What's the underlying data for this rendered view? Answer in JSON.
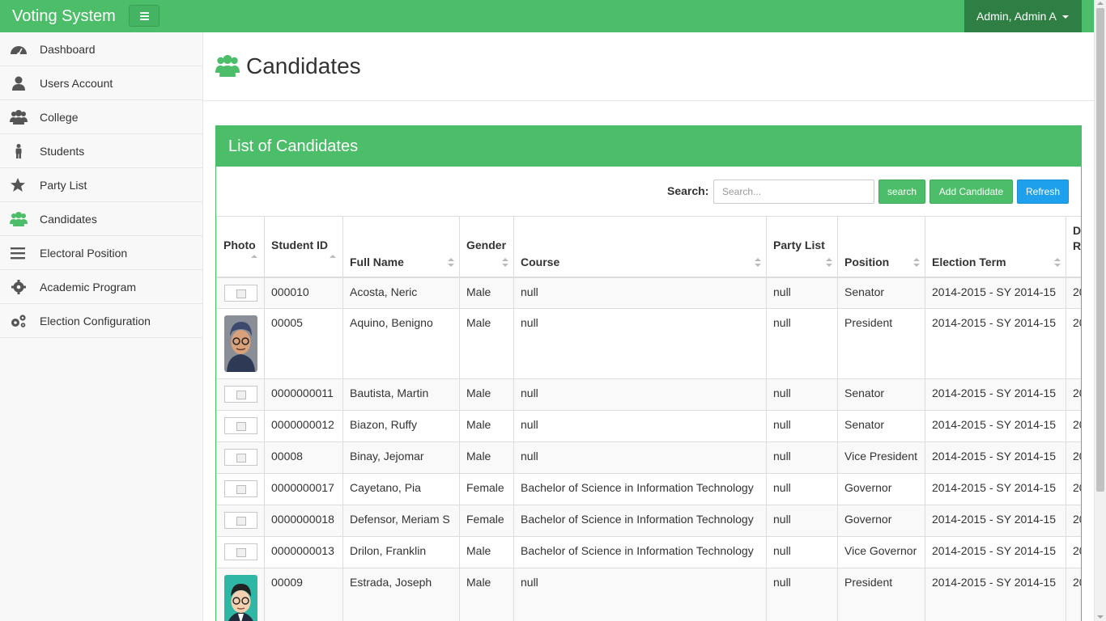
{
  "navbar": {
    "brand": "Voting System",
    "user": "Admin, Admin A"
  },
  "sidebar": {
    "items": [
      {
        "label": "Dashboard",
        "icon": "dashboard-icon"
      },
      {
        "label": "Users Account",
        "icon": "user-icon"
      },
      {
        "label": "College",
        "icon": "users-icon"
      },
      {
        "label": "Students",
        "icon": "male-icon"
      },
      {
        "label": "Party List",
        "icon": "star-icon"
      },
      {
        "label": "Candidates",
        "icon": "users-icon",
        "active": true
      },
      {
        "label": "Electoral Position",
        "icon": "bars-icon"
      },
      {
        "label": "Academic Program",
        "icon": "cog-icon"
      },
      {
        "label": "Election Configuration",
        "icon": "cogs-icon"
      }
    ]
  },
  "page": {
    "title": "Candidates"
  },
  "panel": {
    "title": "List of Candidates",
    "search_label": "Search:",
    "search_placeholder": "Search...",
    "search_value": "",
    "search_button": "search",
    "add_button": "Add Candidate",
    "refresh_button": "Refresh"
  },
  "table": {
    "columns": [
      "Photo",
      "Student ID",
      "Full Name",
      "Gender",
      "Course",
      "Party List",
      "Position",
      "Election Term",
      "Da Re"
    ],
    "last_col_line1": "D",
    "last_col_line2": "R",
    "rows": [
      {
        "photo": "none",
        "id": "000010",
        "name": "Acosta, Neric",
        "gender": "Male",
        "course": "null",
        "party": "null",
        "position": "Senator",
        "term": "2014-2015 - SY 2014-15",
        "extra": "20"
      },
      {
        "photo": "person-a",
        "id": "00005",
        "name": "Aquino, Benigno",
        "gender": "Male",
        "course": "null",
        "party": "null",
        "position": "President",
        "term": "2014-2015 - SY 2014-15",
        "extra": "20"
      },
      {
        "photo": "none",
        "id": "0000000011",
        "name": "Bautista, Martin",
        "gender": "Male",
        "course": "null",
        "party": "null",
        "position": "Senator",
        "term": "2014-2015 - SY 2014-15",
        "extra": "20"
      },
      {
        "photo": "none",
        "id": "0000000012",
        "name": "Biazon, Ruffy",
        "gender": "Male",
        "course": "null",
        "party": "null",
        "position": "Senator",
        "term": "2014-2015 - SY 2014-15",
        "extra": "20"
      },
      {
        "photo": "none",
        "id": "00008",
        "name": "Binay, Jejomar",
        "gender": "Male",
        "course": "null",
        "party": "null",
        "position": "Vice President",
        "term": "2014-2015 - SY 2014-15",
        "extra": "20"
      },
      {
        "photo": "none",
        "id": "0000000017",
        "name": "Cayetano, Pia",
        "gender": "Female",
        "course": "Bachelor of Science in Information Technology",
        "party": "null",
        "position": "Governor",
        "term": "2014-2015 - SY 2014-15",
        "extra": "20"
      },
      {
        "photo": "none",
        "id": "0000000018",
        "name": "Defensor, Meriam S",
        "gender": "Female",
        "course": "Bachelor of Science in Information Technology",
        "party": "null",
        "position": "Governor",
        "term": "2014-2015 - SY 2014-15",
        "extra": "20"
      },
      {
        "photo": "none",
        "id": "0000000013",
        "name": "Drilon, Franklin",
        "gender": "Male",
        "course": "Bachelor of Science in Information Technology",
        "party": "null",
        "position": "Vice Governor",
        "term": "2014-2015 - SY 2014-15",
        "extra": "20"
      },
      {
        "photo": "person-b",
        "id": "00009",
        "name": "Estrada, Joseph",
        "gender": "Male",
        "course": "null",
        "party": "null",
        "position": "President",
        "term": "2014-2015 - SY 2014-15",
        "extra": "20"
      }
    ]
  },
  "colors": {
    "primary": "#4cbe69",
    "user_menu": "#2f7f44",
    "refresh": "#1fa0ed"
  }
}
